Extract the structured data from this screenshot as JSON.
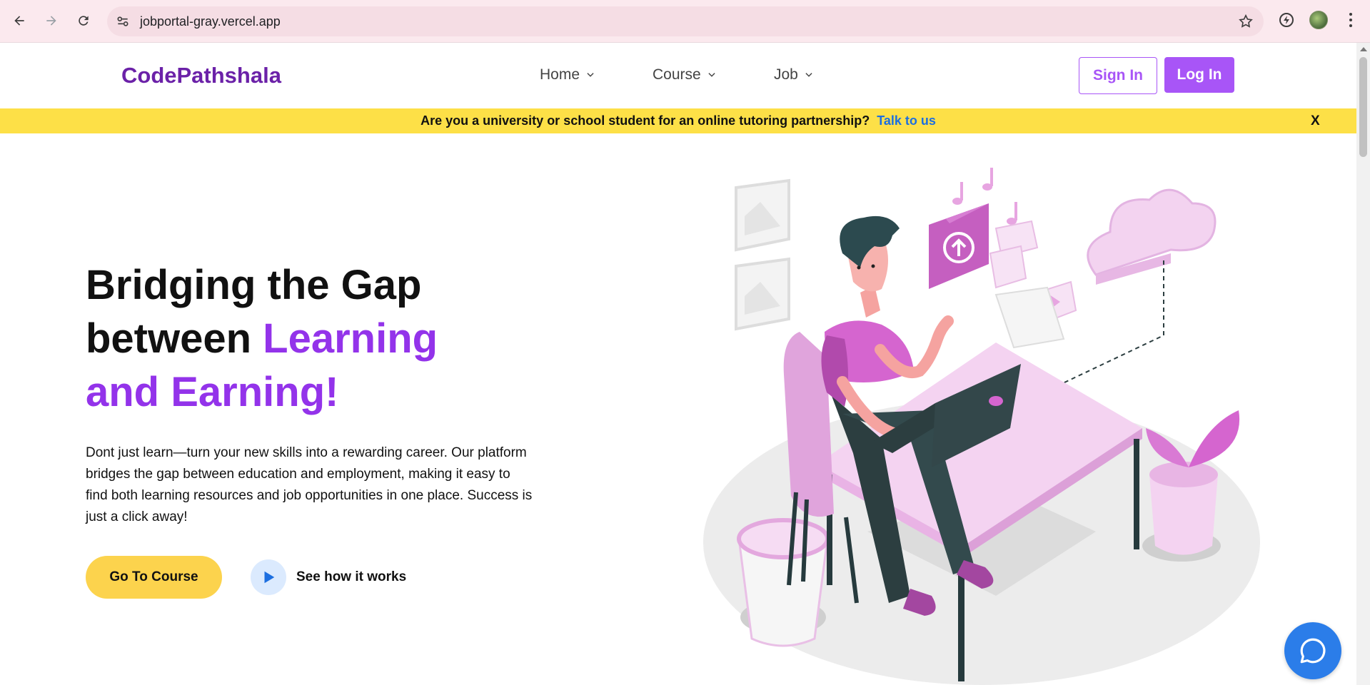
{
  "browser": {
    "url": "jobportal-gray.vercel.app"
  },
  "header": {
    "brand": "CodePathshala",
    "nav": [
      {
        "label": "Home"
      },
      {
        "label": "Course"
      },
      {
        "label": "Job"
      }
    ],
    "signin_label": "Sign In",
    "login_label": "Log In"
  },
  "banner": {
    "text": "Are you a university or school student for an online tutoring partnership?",
    "link": "Talk to us",
    "close": "X"
  },
  "hero": {
    "title_line1": "Bridging the Gap",
    "title_line2a": "between ",
    "title_line2b": "Learning",
    "title_line3": "and Earning!",
    "description": "Dont just learn—turn your new skills into a rewarding career. Our platform bridges the gap between education and employment, making it easy to find both learning resources and job opportunities in one place. Success is just a click away!",
    "cta_label": "Go To Course",
    "how_label": "See how it works"
  },
  "colors": {
    "brand": "#6b21a8",
    "accent": "#a855f7",
    "banner": "#fde047",
    "cta": "#fcd34d",
    "chat": "#2b7de9"
  }
}
